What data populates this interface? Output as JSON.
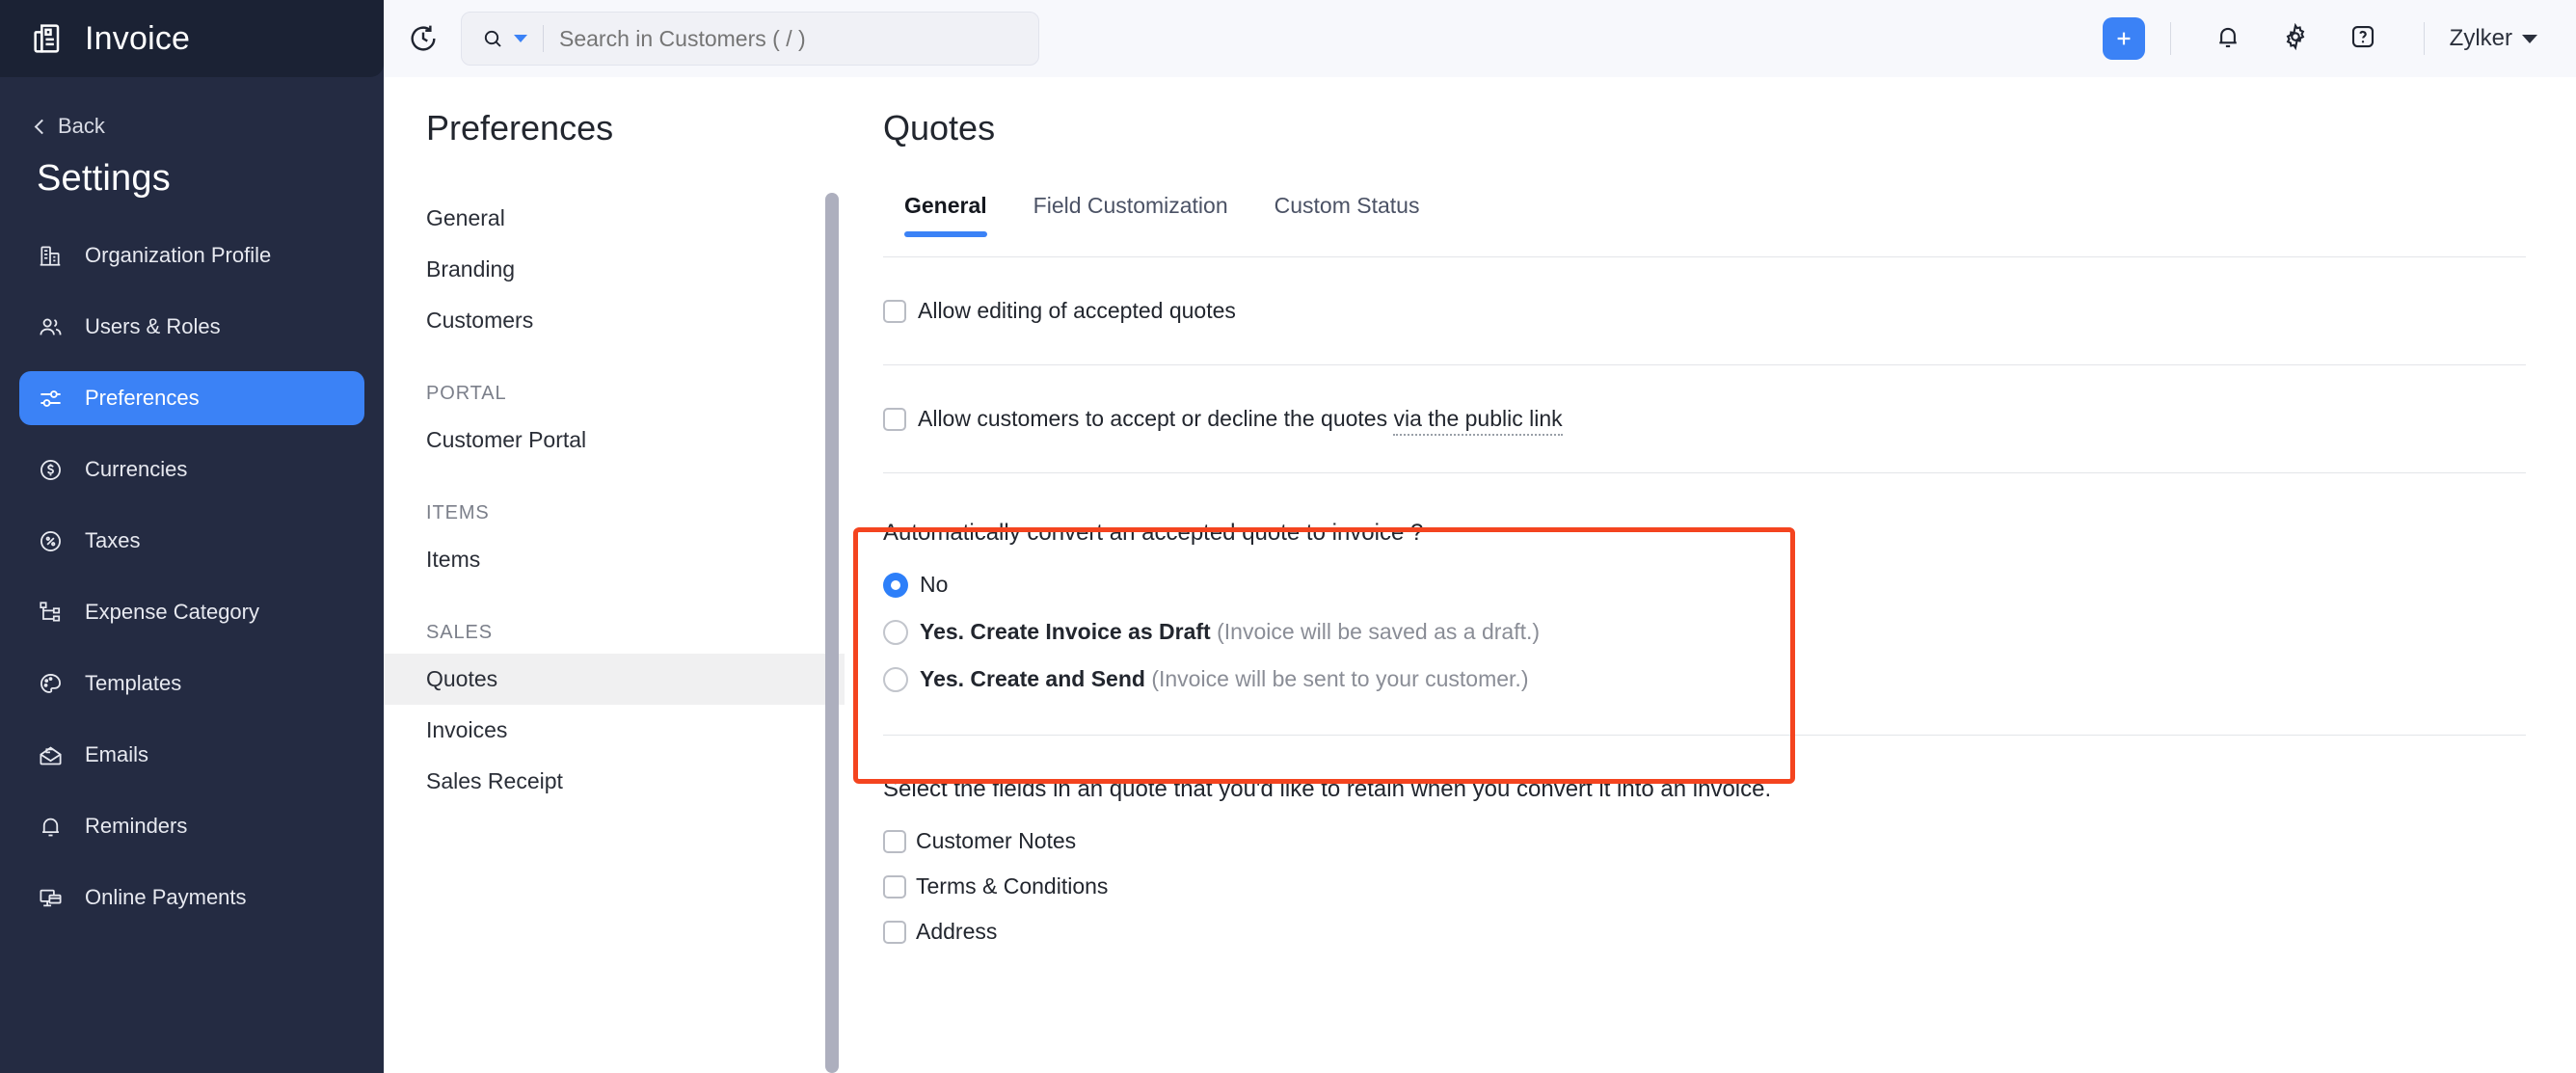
{
  "app": {
    "name": "Invoice",
    "logo_icon": "invoice-document-icon"
  },
  "sidebar": {
    "back_label": "Back",
    "back_icon": "chevron-left-icon",
    "section_title": "Settings",
    "items": [
      {
        "label": "Organization Profile",
        "icon": "building-icon",
        "active": false
      },
      {
        "label": "Users & Roles",
        "icon": "users-icon",
        "active": false
      },
      {
        "label": "Preferences",
        "icon": "sliders-icon",
        "active": true
      },
      {
        "label": "Currencies",
        "icon": "dollar-circle-icon",
        "active": false
      },
      {
        "label": "Taxes",
        "icon": "percent-circle-icon",
        "active": false
      },
      {
        "label": "Expense Category",
        "icon": "hierarchy-icon",
        "active": false
      },
      {
        "label": "Templates",
        "icon": "palette-icon",
        "active": false
      },
      {
        "label": "Emails",
        "icon": "envelope-icon",
        "active": false
      },
      {
        "label": "Reminders",
        "icon": "bell-icon",
        "active": false
      },
      {
        "label": "Online Payments",
        "icon": "card-terminal-icon",
        "active": false
      }
    ],
    "active_color": "#3B82F6",
    "background": "#242B42"
  },
  "topbar": {
    "refresh_icon": "clock-refresh-icon",
    "search": {
      "icon": "search-icon",
      "dropdown_icon": "chevron-down-icon",
      "placeholder": "Search in Customers ( / )",
      "value": ""
    },
    "add_button": {
      "label": "+",
      "icon": "plus-icon",
      "color": "#3B82F6"
    },
    "notifications_icon": "bell-icon",
    "settings_icon": "gear-icon",
    "help_icon": "question-mark-icon",
    "org": {
      "name": "Zylker",
      "chevron_icon": "chevron-down-icon"
    }
  },
  "preferences_panel": {
    "title": "Preferences",
    "items": [
      {
        "label": "General",
        "type": "item",
        "selected": false
      },
      {
        "label": "Branding",
        "type": "item",
        "selected": false
      },
      {
        "label": "Customers",
        "type": "item",
        "selected": false
      },
      {
        "label": "PORTAL",
        "type": "group"
      },
      {
        "label": "Customer Portal",
        "type": "item",
        "selected": false
      },
      {
        "label": "ITEMS",
        "type": "group"
      },
      {
        "label": "Items",
        "type": "item",
        "selected": false
      },
      {
        "label": "SALES",
        "type": "group"
      },
      {
        "label": "Quotes",
        "type": "item",
        "selected": true
      },
      {
        "label": "Invoices",
        "type": "item",
        "selected": false
      },
      {
        "label": "Sales Receipt",
        "type": "item",
        "selected": false
      }
    ]
  },
  "main": {
    "title": "Quotes",
    "tabs": [
      {
        "label": "General",
        "active": true
      },
      {
        "label": "Field Customization",
        "active": false
      },
      {
        "label": "Custom Status",
        "active": false
      }
    ],
    "settings": {
      "allow_editing": {
        "label": "Allow editing of accepted quotes",
        "checked": false
      },
      "allow_public_accept": {
        "label_part1": "Allow customers to accept or decline the quotes ",
        "label_link": "via the public link",
        "checked": false
      }
    },
    "auto_convert": {
      "question": "Automatically convert an accepted quote to invoice ?",
      "highlight_color": "#F4441F",
      "options": [
        {
          "label": "No",
          "note": "",
          "selected": true
        },
        {
          "label": "Yes. Create Invoice as Draft",
          "note": " (Invoice will be saved as a draft.)",
          "selected": false
        },
        {
          "label": "Yes. Create and Send",
          "note": " (Invoice will be sent to your customer.)",
          "selected": false
        }
      ]
    },
    "retain_fields": {
      "title": "Select the fields in an quote that you'd like to retain when you convert it into an invoice.",
      "options": [
        {
          "label": "Customer Notes",
          "checked": false
        },
        {
          "label": "Terms & Conditions",
          "checked": false
        },
        {
          "label": "Address",
          "checked": false
        }
      ]
    }
  }
}
